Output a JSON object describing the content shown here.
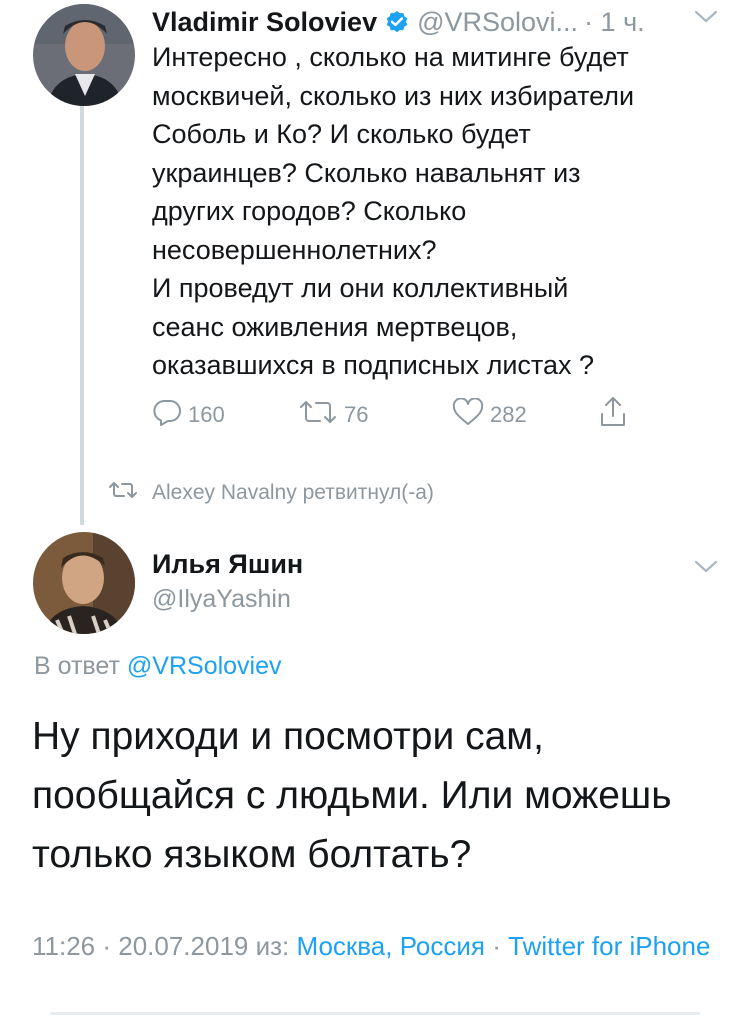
{
  "tweet1": {
    "display_name": "Vladimir Soloviev",
    "handle": "@VRSolovi...",
    "time": "· 1 ч.",
    "text": "Интересно , сколько на митинге будет\nмосквичей, сколько из них избиратели\nСоболь и Ко? И сколько будет\nукраинцев? Сколько навальнят из\nдругих городов? Сколько\nнесовершеннолетних?\nИ проведут ли они коллективный\nсеанс оживления мертвецов,\nоказавшихся в подписных листах ?",
    "replies": "160",
    "retweets": "76",
    "likes": "282"
  },
  "retweet_notice": "Alexey Navalny ретвитнул(-а)",
  "tweet2": {
    "display_name": "Илья Яшин",
    "handle": "@IlyaYashin",
    "reply_prefix": "В ответ",
    "reply_handle": "@VRSoloviev",
    "text": "Ну приходи и посмотри сам, пообщайся с людьми. Или можешь только языком болтать?",
    "time_date": "11:26 · 20.07.2019 из:",
    "location": "Москва, Россия",
    "separator": "·",
    "client": "Twitter for iPhone"
  },
  "colors": {
    "link": "#1da1f2",
    "secondary": "#8d979f",
    "text": "#14171a",
    "verified": "#1da1f2"
  },
  "icons": [
    "verified-badge-icon",
    "chevron-down-icon",
    "reply-icon",
    "retweet-icon",
    "like-icon",
    "share-icon"
  ]
}
